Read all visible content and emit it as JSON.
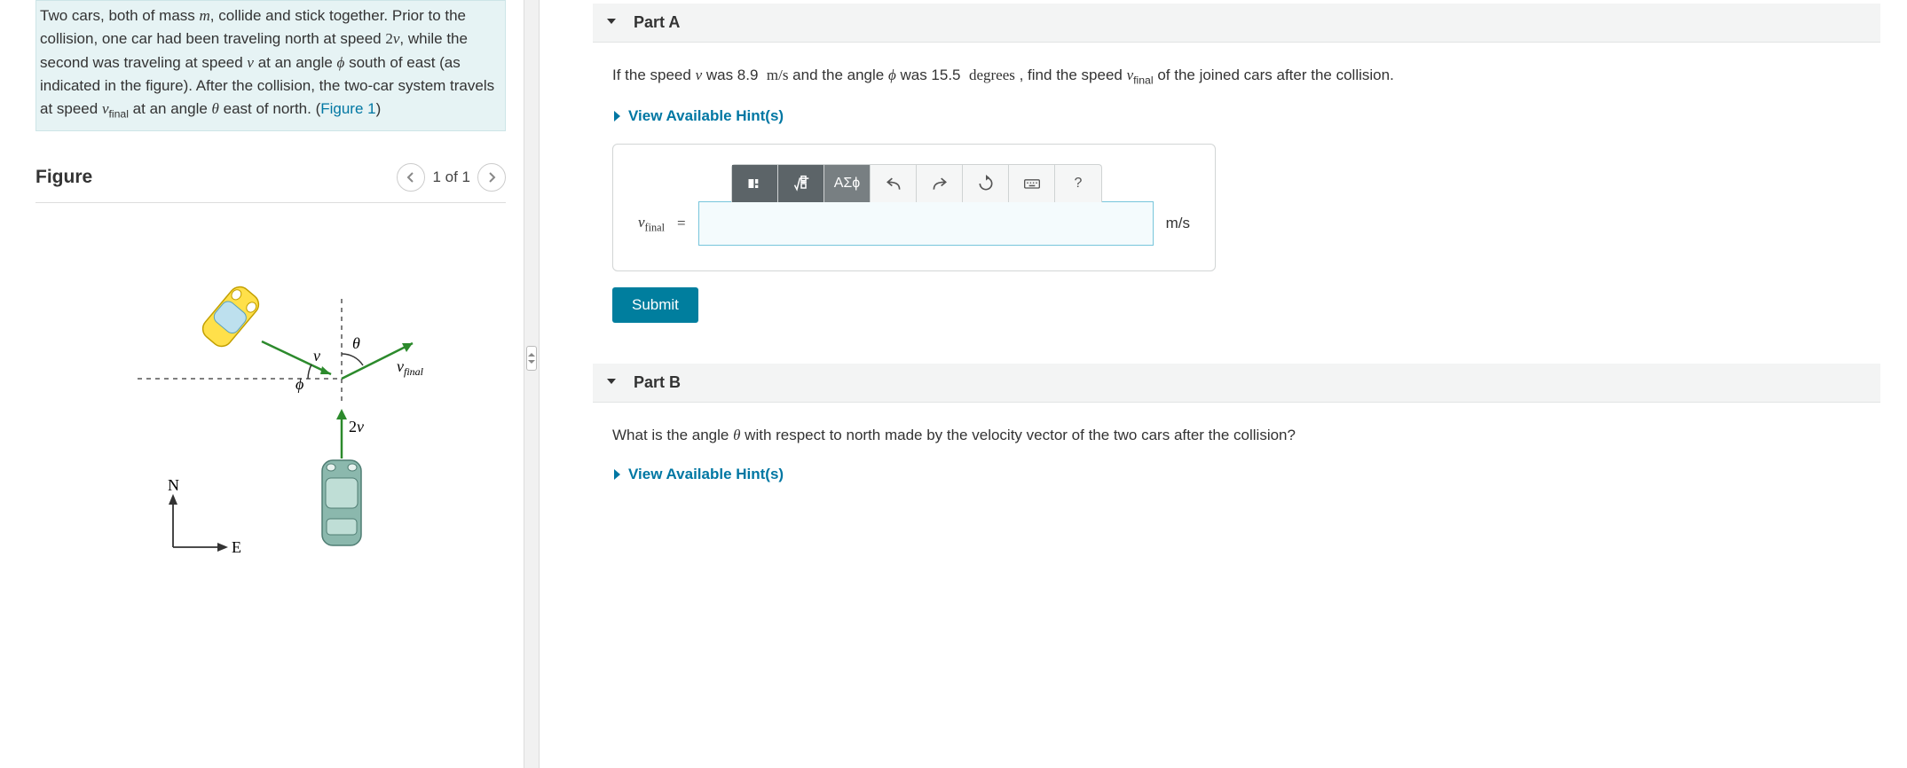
{
  "problem": {
    "text_html": "Two cars, both of mass <span class='mi'>m</span>, collide and stick together. Prior to the collision, one car had been traveling north at speed <span class='mn'>2</span><span class='mi'>v</span>, while the second was traveling at speed <span class='mi'>v</span> at an angle <span class='mi'>ϕ</span> south of east (as indicated in the figure). After the collision, the two-car system travels at speed <span class='mi'>v</span><span class='sub'>final</span> at an angle <span class='mi'>θ</span> east of north. (<span class='link'>Figure 1</span>)"
  },
  "figure": {
    "title": "Figure",
    "pager": "1 of 1",
    "labels": {
      "theta": "θ",
      "phi": "ϕ",
      "v": "v",
      "vfinal": "vfinal",
      "speed2v": "2v",
      "N": "N",
      "E": "E"
    }
  },
  "partA": {
    "title": "Part A",
    "question_html": "If the speed <span class='mi'>v</span> was 8.9&nbsp; <span class='mn'>m/s</span> and the angle <span class='mi'>ϕ</span> was 15.5&nbsp; <span class='mn'>degrees</span> , find the speed <span class='mi'>v</span><span class='sub'>final</span> of the joined cars after the collision.",
    "hints_label": "View Available Hint(s)",
    "answer_label_html": "<span class='mi'>v</span><span class='sub'>final</span>",
    "eq": "=",
    "units": "m/s",
    "submit": "Submit",
    "toolbar": {
      "templates": "templates-icon",
      "fraction": "fraction-sqrt-icon",
      "greek": "ΑΣϕ",
      "undo": "undo-icon",
      "redo": "redo-icon",
      "reset": "reset-icon",
      "keyboard": "keyboard-icon",
      "help": "?"
    }
  },
  "partB": {
    "title": "Part B",
    "question_html": "What is the angle <span class='mi'>θ</span> with respect to north made by the velocity vector of the two cars after the collision?",
    "hints_label": "View Available Hint(s)"
  }
}
